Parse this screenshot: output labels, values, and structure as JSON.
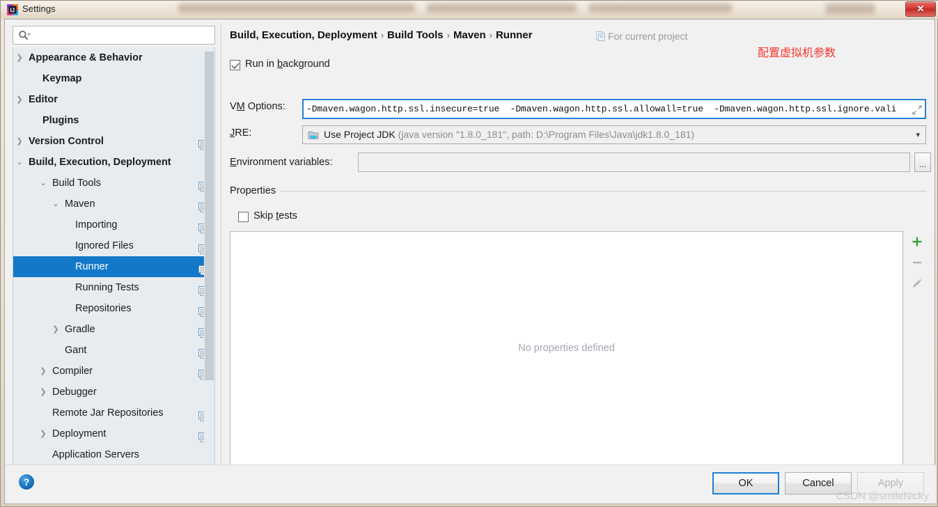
{
  "window": {
    "title": "Settings",
    "app_icon": "intellij-idea-icon",
    "close_label": "✕"
  },
  "search": {
    "value": "",
    "placeholder": "",
    "icon": "search-icon"
  },
  "sidebar": {
    "scrollbar": "vertical-scrollbar",
    "items": [
      {
        "label": "Appearance & Behavior",
        "indent": 22,
        "bold": true,
        "arrow": "right",
        "copy": false,
        "selected": false
      },
      {
        "label": "Keymap",
        "indent": 42,
        "bold": true,
        "arrow": "",
        "copy": false,
        "selected": false
      },
      {
        "label": "Editor",
        "indent": 22,
        "bold": true,
        "arrow": "right",
        "copy": false,
        "selected": false
      },
      {
        "label": "Plugins",
        "indent": 42,
        "bold": true,
        "arrow": "",
        "copy": false,
        "selected": false
      },
      {
        "label": "Version Control",
        "indent": 22,
        "bold": true,
        "arrow": "right",
        "copy": true,
        "selected": false
      },
      {
        "label": "Build, Execution, Deployment",
        "indent": 22,
        "bold": true,
        "arrow": "down",
        "copy": false,
        "selected": false
      },
      {
        "label": "Build Tools",
        "indent": 56,
        "bold": false,
        "arrow": "down",
        "copy": true,
        "selected": false
      },
      {
        "label": "Maven",
        "indent": 74,
        "bold": false,
        "arrow": "down",
        "copy": true,
        "selected": false
      },
      {
        "label": "Importing",
        "indent": 89,
        "bold": false,
        "arrow": "",
        "copy": true,
        "selected": false
      },
      {
        "label": "Ignored Files",
        "indent": 89,
        "bold": false,
        "arrow": "",
        "copy": true,
        "selected": false
      },
      {
        "label": "Runner",
        "indent": 89,
        "bold": false,
        "arrow": "",
        "copy": true,
        "selected": true
      },
      {
        "label": "Running Tests",
        "indent": 89,
        "bold": false,
        "arrow": "",
        "copy": true,
        "selected": false
      },
      {
        "label": "Repositories",
        "indent": 89,
        "bold": false,
        "arrow": "",
        "copy": true,
        "selected": false
      },
      {
        "label": "Gradle",
        "indent": 74,
        "bold": false,
        "arrow": "right",
        "copy": true,
        "selected": false
      },
      {
        "label": "Gant",
        "indent": 74,
        "bold": false,
        "arrow": "",
        "copy": true,
        "selected": false
      },
      {
        "label": "Compiler",
        "indent": 56,
        "bold": false,
        "arrow": "right",
        "copy": true,
        "selected": false
      },
      {
        "label": "Debugger",
        "indent": 56,
        "bold": false,
        "arrow": "right",
        "copy": false,
        "selected": false
      },
      {
        "label": "Remote Jar Repositories",
        "indent": 56,
        "bold": false,
        "arrow": "",
        "copy": true,
        "selected": false
      },
      {
        "label": "Deployment",
        "indent": 56,
        "bold": false,
        "arrow": "right",
        "copy": true,
        "selected": false
      },
      {
        "label": "Application Servers",
        "indent": 56,
        "bold": false,
        "arrow": "",
        "copy": false,
        "selected": false
      }
    ]
  },
  "breadcrumb": {
    "parts": [
      "Build, Execution, Deployment",
      "Build Tools",
      "Maven",
      "Runner"
    ],
    "separator": "›",
    "scope_label": "For current project",
    "scope_icon": "project-scope-icon"
  },
  "annotation": {
    "text": "配置虚拟机参数",
    "color": "#f4372c"
  },
  "form": {
    "run_in_background": {
      "label_pre": "Run in ",
      "label_mnemonic": "b",
      "label_post": "ackground",
      "checked": true
    },
    "vm_options": {
      "label_pre": "V",
      "label_mnemonic": "M",
      "label_post": " Options:",
      "value": "-Dmaven.wagon.http.ssl.insecure=true  -Dmaven.wagon.http.ssl.allowall=true  -Dmaven.wagon.http.ssl.ignore.vali",
      "expand_icon": "expand-icon",
      "focused": true
    },
    "jre": {
      "label_pre": "",
      "label_mnemonic": "J",
      "label_post": "RE:",
      "selected_strong": "Use Project JDK",
      "selected_dim": "(java version \"1.8.0_181\", path: D:\\Program Files\\Java\\jdk1.8.0_181)",
      "icon": "jdk-folder-icon",
      "caret_icon": "chevron-down-icon"
    },
    "env_variables": {
      "label_pre": "",
      "label_mnemonic": "E",
      "label_post": "nvironment variables:",
      "value": "",
      "browse_label": "..."
    }
  },
  "properties": {
    "group_title": "Properties",
    "skip_tests": {
      "label_pre": "Skip ",
      "label_mnemonic": "t",
      "label_post": "ests",
      "checked": false
    },
    "empty_text": "No properties defined",
    "toolbar": [
      {
        "name": "add-property-button",
        "glyph": "+",
        "color": "#3aa03a",
        "enabled": true
      },
      {
        "name": "remove-property-button",
        "glyph": "−",
        "color": "#b3b3b3",
        "enabled": false
      },
      {
        "name": "edit-property-button",
        "glyph": "✎",
        "color": "#b6b6b6",
        "enabled": false
      }
    ]
  },
  "footer": {
    "help_label": "?",
    "ok_label": "OK",
    "cancel_label": "Cancel",
    "apply_label": "Apply",
    "watermark": "CSDN @smileNicky"
  }
}
